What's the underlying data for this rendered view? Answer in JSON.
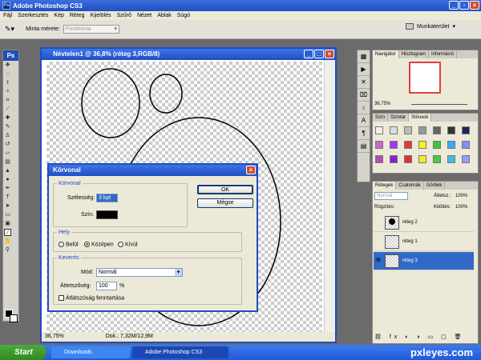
{
  "app": {
    "title": "Adobe Photoshop CS3",
    "icon": "Ps"
  },
  "menu": [
    "Fájl",
    "Szerkesztés",
    "Kép",
    "Réteg",
    "Kijelölés",
    "Szűrő",
    "Nézet",
    "Ablak",
    "Súgó"
  ],
  "options": {
    "sample_label": "Minta mérete:",
    "sample_value": "Pontminta",
    "workspace_label": "Munkaterület"
  },
  "document": {
    "title": "Névtelen1 @ 36,8% (réteg 3,RGB/8)",
    "zoom": "36,75%",
    "doc_info": "Dok.: 7,32M/12,9M"
  },
  "dialog": {
    "title": "Körvonal",
    "group_stroke": "Körvonal",
    "width_label": "Szélesség:",
    "width_value": "3 kpt",
    "color_label": "Szín:",
    "color_value": "#000000",
    "ok": "OK",
    "cancel": "Mégse",
    "group_location": "Hely",
    "loc_inside": "Belül",
    "loc_center": "Középen",
    "loc_outside": "Kívül",
    "selected_location": "Középen",
    "group_blend": "Keverés",
    "mode_label": "Mód:",
    "mode_value": "Normál",
    "opacity_label": "Áttetszőség:",
    "opacity_value": "100",
    "opacity_unit": "%",
    "preserve_label": "Átlátszóság fenntartása"
  },
  "navigator": {
    "tabs": [
      "Navigátor",
      "Hisztogram",
      "Információ"
    ],
    "zoom": "36,75%"
  },
  "swatches": {
    "tabs": [
      "Szín",
      "Színtár",
      "Stílusok"
    ]
  },
  "layers": {
    "tabs": [
      "Rétegek",
      "Csatornák",
      "Görbék"
    ],
    "blend": "Normál",
    "opacity_label": "Áttetsz.:",
    "opacity_value": "100%",
    "lock_label": "Rögzítés:",
    "fill_label": "Kitöltés:",
    "fill_value": "100%",
    "items": [
      {
        "name": "réteg 2",
        "selected": false
      },
      {
        "name": "réteg 1",
        "selected": false
      },
      {
        "name": "réteg 3",
        "selected": true
      }
    ]
  },
  "taskbar": {
    "start": "Start",
    "tasks": [
      "Downloads",
      "Adobe Photoshop CS3"
    ],
    "watermark": "pxleyes.com"
  },
  "colors": {
    "accent": "#1f4ec2",
    "selection": "#3169c6",
    "close": "#d24a2b"
  }
}
